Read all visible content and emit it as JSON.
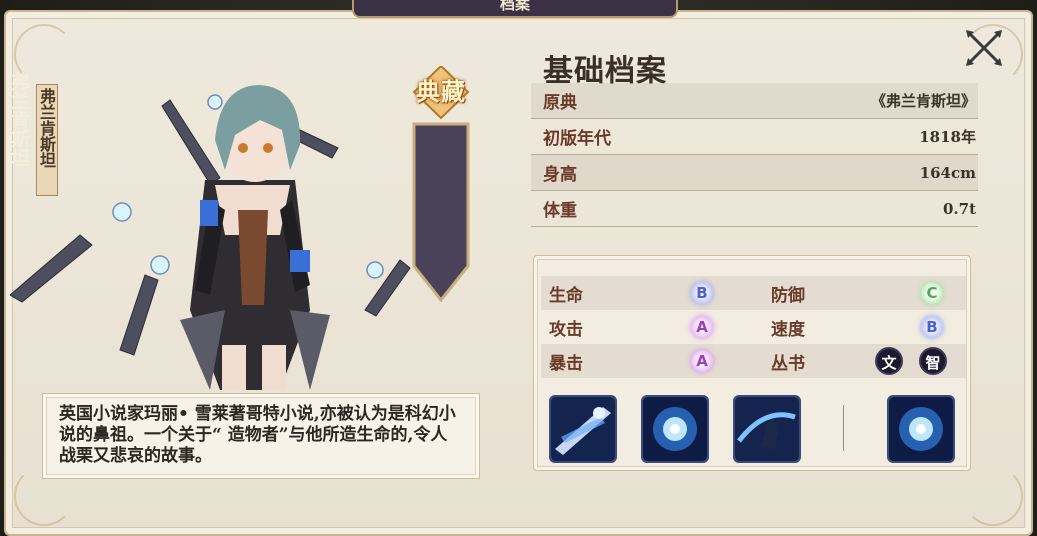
{
  "header": {
    "tab_title": "档案"
  },
  "banner": {
    "badge": "典藏",
    "name_big": "弗兰肯斯坦",
    "name_small": "弗兰肯斯坦"
  },
  "profile": {
    "title": "基础档案",
    "rows": [
      {
        "label": "原典",
        "value": "《弗兰肯斯坦》"
      },
      {
        "label": "初版年代",
        "value": "1818年"
      },
      {
        "label": "身高",
        "value": "164cm"
      },
      {
        "label": "体重",
        "value": "0.7t"
      }
    ]
  },
  "stats": {
    "hp": {
      "label": "生命",
      "grade": "B"
    },
    "def": {
      "label": "防御",
      "grade": "C"
    },
    "atk": {
      "label": "攻击",
      "grade": "A"
    },
    "spd": {
      "label": "速度",
      "grade": "B"
    },
    "crit": {
      "label": "暴击",
      "grade": "A"
    },
    "series": {
      "label": "丛书",
      "badges": [
        "文",
        "智"
      ]
    }
  },
  "description": "英国小说家玛丽• 雪莱著哥特小说,亦被认为是科幻小说的鼻祖。一个关于“ 造物者”与他所造生命的,令人战栗又悲哀的故事。",
  "colors": {
    "accent": "#6a3b28",
    "panel": "#efe9dd",
    "banner": "#4a4258"
  },
  "icons": {
    "close": "crossed-swords-close-icon",
    "skills": [
      "blade-slash-skill-icon",
      "energy-orb-skill-icon",
      "dash-strike-skill-icon",
      "energy-orb-passive-icon"
    ]
  }
}
